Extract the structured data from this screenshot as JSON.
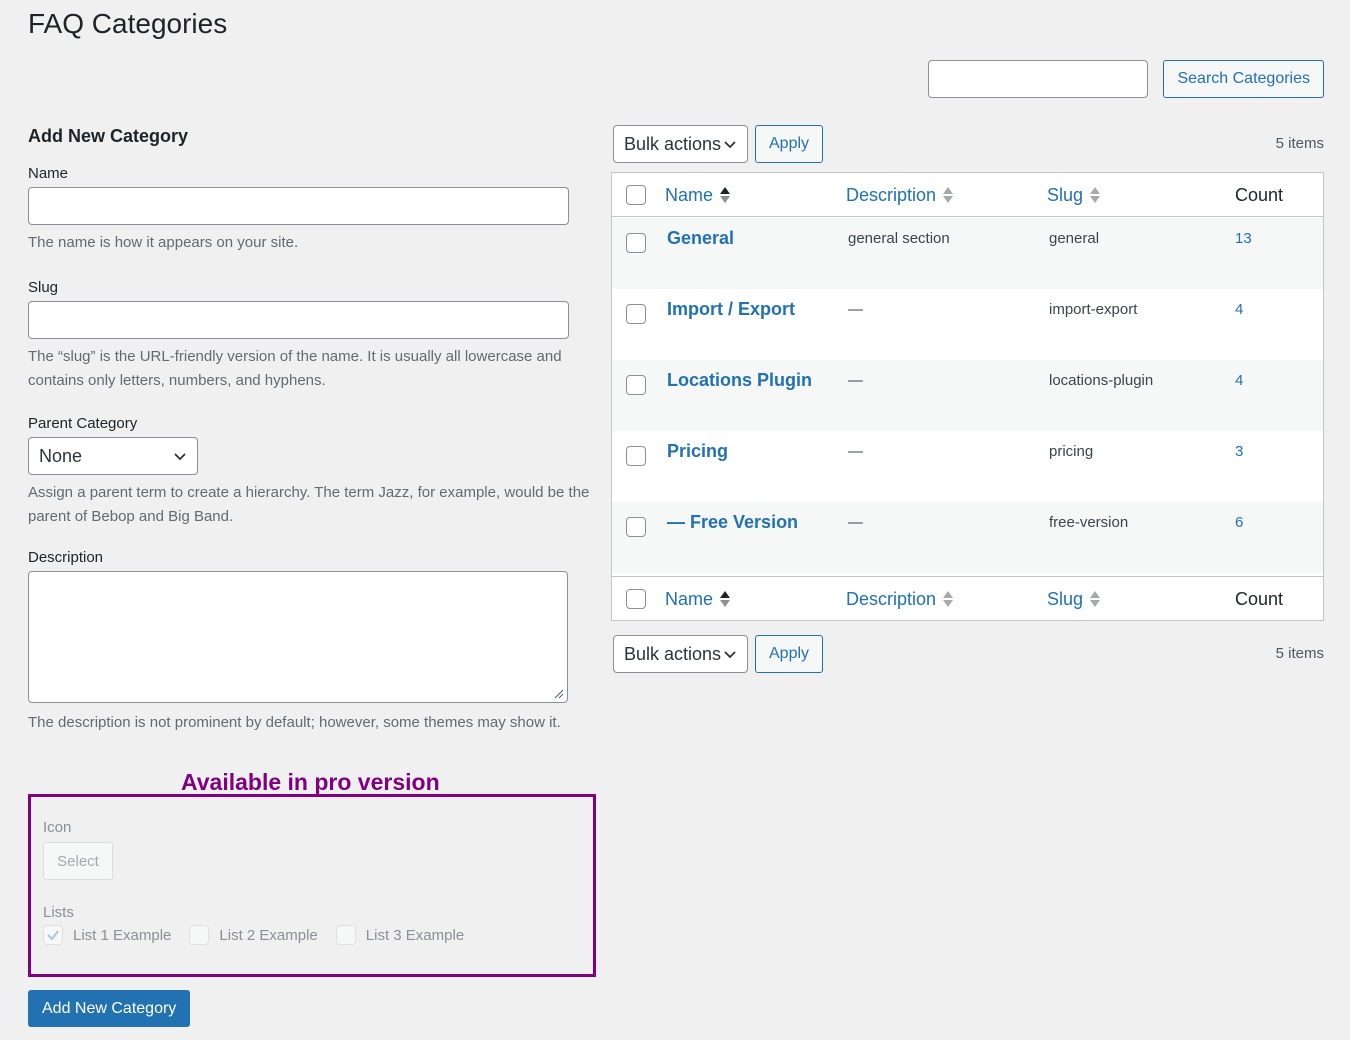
{
  "page": {
    "title": "FAQ Categories"
  },
  "search": {
    "placeholder": "",
    "button": "Search Categories"
  },
  "form": {
    "heading": "Add New Category",
    "name": {
      "label": "Name",
      "value": "",
      "help": "The name is how it appears on your site."
    },
    "slug": {
      "label": "Slug",
      "value": "",
      "help": "The “slug” is the URL-friendly version of the name. It is usually all lowercase and contains only letters, numbers, and hyphens."
    },
    "parent": {
      "label": "Parent Category",
      "selected": "None",
      "help": "Assign a parent term to create a hierarchy. The term Jazz, for example, would be the parent of Bebop and Big Band."
    },
    "description": {
      "label": "Description",
      "value": "",
      "help": "The description is not prominent by default; however, some themes may show it."
    },
    "submit": "Add New Category"
  },
  "pro": {
    "caption": "Available in pro version",
    "icon_label": "Icon",
    "icon_button": "Select",
    "lists_label": "Lists",
    "lists": [
      {
        "label": "List 1 Example",
        "checked": true
      },
      {
        "label": "List 2 Example",
        "checked": false
      },
      {
        "label": "List 3 Example",
        "checked": false
      }
    ]
  },
  "tablenav": {
    "bulk_label": "Bulk actions",
    "apply": "Apply",
    "count": "5 items"
  },
  "table": {
    "headers": {
      "name": "Name",
      "description": "Description",
      "slug": "Slug",
      "count": "Count"
    },
    "rows": [
      {
        "name": "General",
        "description": "general section",
        "slug": "general",
        "count": "13"
      },
      {
        "name": "Import / Export",
        "description": "—",
        "slug": "import-export",
        "count": "4"
      },
      {
        "name": "Locations Plugin",
        "description": "—",
        "slug": "locations-plugin",
        "count": "4"
      },
      {
        "name": "Pricing",
        "description": "—",
        "slug": "pricing",
        "count": "3"
      },
      {
        "name": "— Free Version",
        "description": "—",
        "slug": "free-version",
        "count": "6"
      }
    ]
  },
  "colors": {
    "accent": "#2271b1",
    "pro": "#800080",
    "background": "#f0f0f1"
  }
}
